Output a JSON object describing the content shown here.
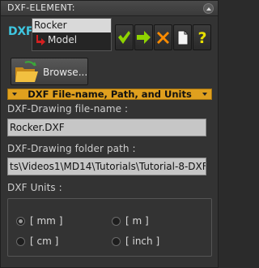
{
  "window": {
    "title": "DXF-ELEMENT:"
  },
  "logo": {
    "text": "DXF"
  },
  "tree": {
    "selected_item": "Rocker",
    "child_item": "Model"
  },
  "toolbar": {
    "buttons": [
      {
        "icon": "checkmark-icon",
        "color": "#8fd400"
      },
      {
        "icon": "arrow-right-icon",
        "color": "#8fd400"
      },
      {
        "icon": "close-x-icon",
        "color": "#ff8c00"
      },
      {
        "icon": "document-icon",
        "color": "#e8e8e8"
      },
      {
        "icon": "help-icon",
        "color": "#e8e000"
      }
    ]
  },
  "browse": {
    "label": "Browse..."
  },
  "section": {
    "title": "DXF File-name, Path, and Units",
    "color": "#e0a01e"
  },
  "fields": {
    "file_name_label": "DXF-Drawing file-name :",
    "file_name_value": "Rocker.DXF",
    "folder_path_label": "DXF-Drawing folder path :",
    "folder_path_value": "ts\\Videos1\\MD14\\Tutorials\\Tutorial-8-DXF\\"
  },
  "units": {
    "label": "DXF Units :",
    "options": [
      "[ mm ]",
      "[ m ]",
      "[ cm ]",
      "[ inch ]"
    ],
    "selected": "[ mm ]"
  }
}
